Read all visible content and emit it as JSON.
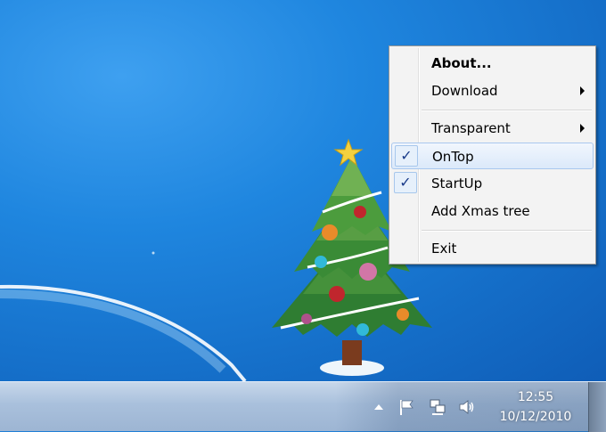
{
  "menu": {
    "items": [
      {
        "label": "About...",
        "bold": true
      },
      {
        "label": "Download",
        "submenu": true
      },
      {
        "label": "Transparent",
        "submenu": true
      },
      {
        "label": "OnTop",
        "checked": true,
        "highlighted": true
      },
      {
        "label": "StartUp",
        "checked": true
      },
      {
        "label": "Add Xmas tree"
      },
      {
        "label": "Exit"
      }
    ],
    "check_glyph": "✓"
  },
  "taskbar": {
    "clock_time": "12:55",
    "clock_date": "10/12/2010",
    "tray_icons": [
      "show-hidden-icons-arrow",
      "action-center-flag-icon",
      "network-icon",
      "volume-icon"
    ]
  },
  "colors": {
    "desktop": "#1f86df",
    "menu_bg": "#f3f3f3",
    "highlight_border": "#a9c8ee",
    "taskbar": "#a9c0dc"
  }
}
